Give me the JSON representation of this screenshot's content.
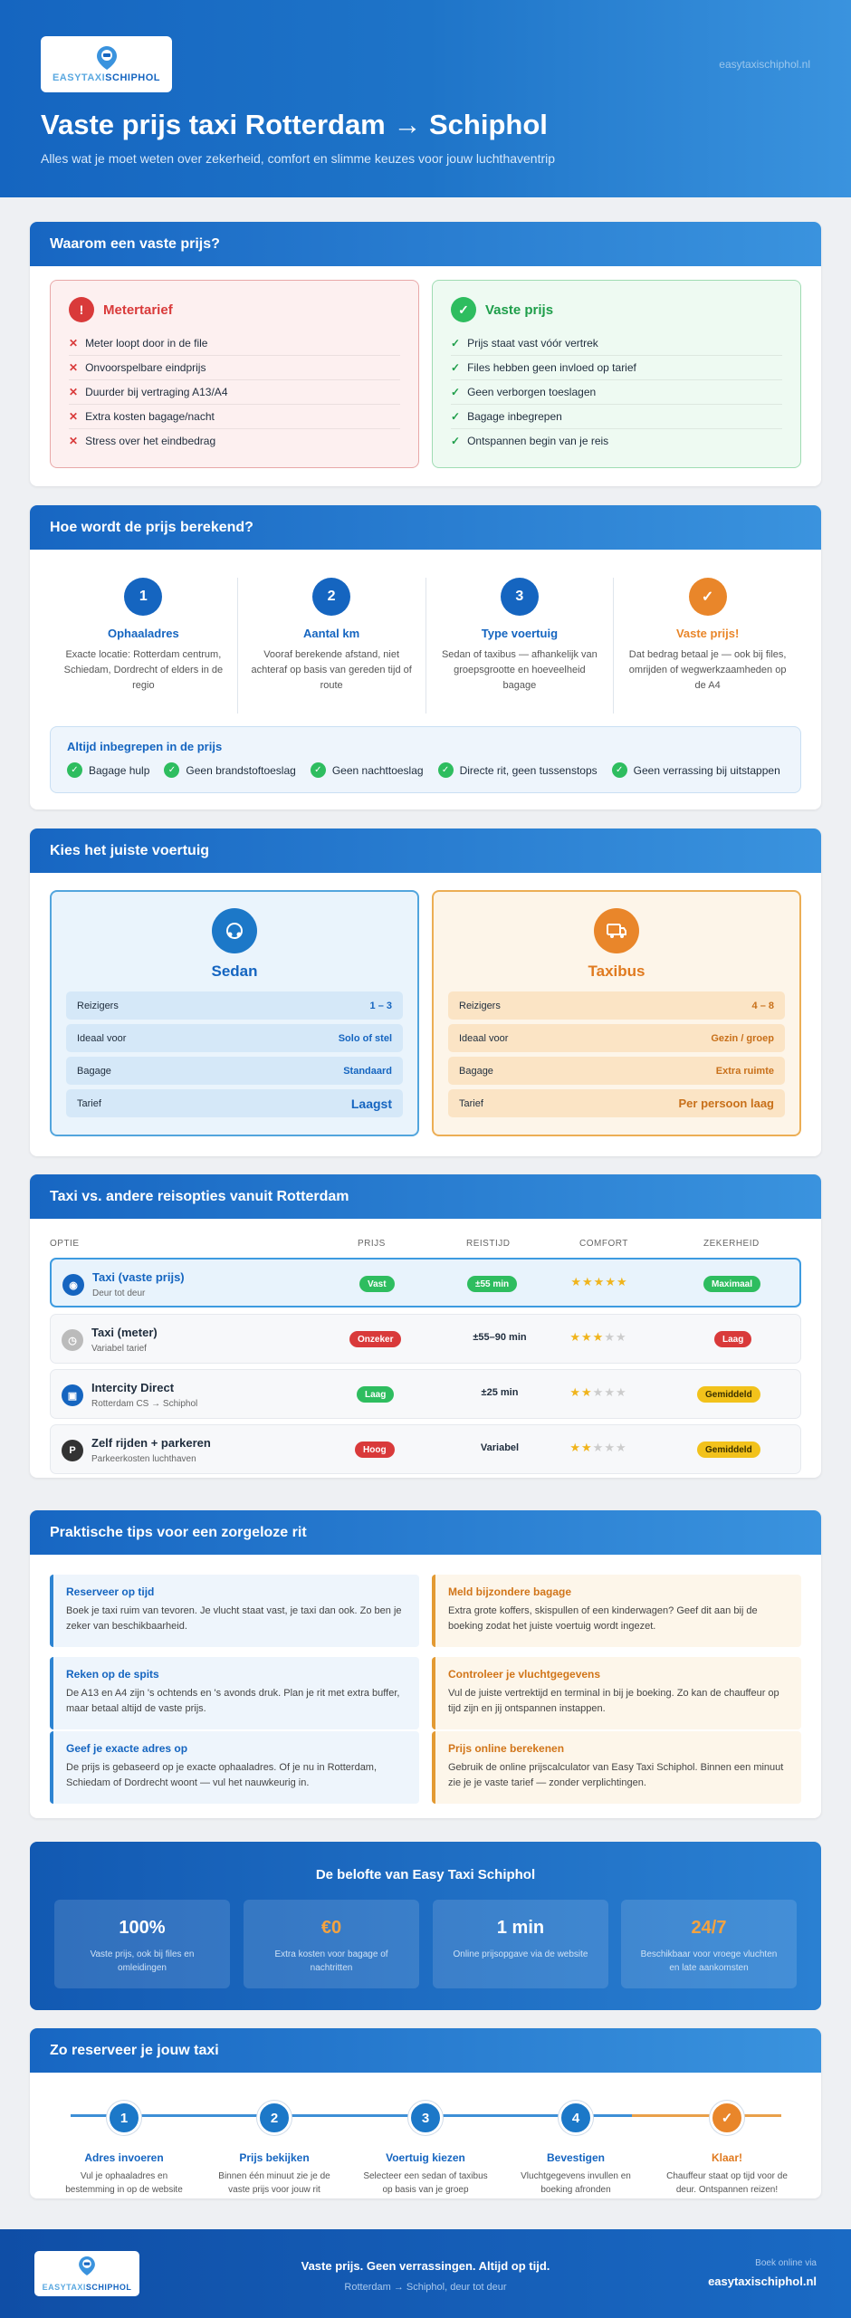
{
  "header": {
    "logo_text_a": "EASYTAXI",
    "logo_text_b": "SCHIPHOL",
    "url": "easytaxischiphol.nl",
    "title": "Vaste prijs taxi Rotterdam → Schiphol",
    "subtitle": "Alles wat je moet weten over zekerheid, comfort en slimme keuzes voor jouw luchthaventrip"
  },
  "why": {
    "heading": "Waarom een vaste prijs?",
    "meter": {
      "title": "Metertarief",
      "items": [
        "Meter loopt door in de file",
        "Onvoorspelbare eindprijs",
        "Duurder bij vertraging A13/A4",
        "Extra kosten bagage/nacht",
        "Stress over het eindbedrag"
      ]
    },
    "fixed": {
      "title": "Vaste prijs",
      "items": [
        "Prijs staat vast vóór vertrek",
        "Files hebben geen invloed op tarief",
        "Geen verborgen toeslagen",
        "Bagage inbegrepen",
        "Ontspannen begin van je reis"
      ]
    }
  },
  "calc": {
    "heading": "Hoe wordt de prijs berekend?",
    "steps": [
      {
        "num": "1",
        "title": "Ophaaladres",
        "desc": "Exacte locatie: Rotterdam centrum, Schiedam, Dordrecht of elders in de regio"
      },
      {
        "num": "2",
        "title": "Aantal km",
        "desc": "Vooraf berekende afstand, niet achteraf op basis van gereden tijd of route"
      },
      {
        "num": "3",
        "title": "Type voertuig",
        "desc": "Sedan of taxibus — afhankelijk van groepsgrootte en hoeveelheid bagage"
      },
      {
        "num": "✓",
        "title": "Vaste prijs!",
        "desc": "Dat bedrag betaal je — ook bij files, omrijden of wegwerkzaamheden op de A4"
      }
    ],
    "included_title": "Altijd inbegrepen in de prijs",
    "included": [
      "Bagage hulp",
      "Geen brandstoftoeslag",
      "Geen nachttoeslag",
      "Directe rit, geen tussenstops",
      "Geen verrassing bij uitstappen"
    ]
  },
  "vehicles": {
    "heading": "Kies het juiste voertuig",
    "sedan": {
      "name": "Sedan",
      "rows": [
        {
          "label": "Reizigers",
          "value": "1 – 3"
        },
        {
          "label": "Ideaal voor",
          "value": "Solo of stel"
        },
        {
          "label": "Bagage",
          "value": "Standaard"
        },
        {
          "label": "Tarief",
          "value": "Laagst"
        }
      ]
    },
    "bus": {
      "name": "Taxibus",
      "rows": [
        {
          "label": "Reizigers",
          "value": "4 – 8"
        },
        {
          "label": "Ideaal voor",
          "value": "Gezin / groep"
        },
        {
          "label": "Bagage",
          "value": "Extra ruimte"
        },
        {
          "label": "Tarief",
          "value": "Per persoon laag"
        }
      ]
    }
  },
  "compare": {
    "heading": "Taxi vs. andere reisopties vanuit Rotterdam",
    "columns": [
      "OPTIE",
      "PRIJS",
      "REISTIJD",
      "COMFORT",
      "ZEKERHEID"
    ],
    "rows": [
      {
        "name": "Taxi (vaste prijs)",
        "sub": "Deur tot deur",
        "price": "Vast",
        "time": "±55 min",
        "stars": "★★★★★",
        "stars_off": "",
        "certainty": "Maximaal",
        "icon": "taxi-icon",
        "icon_glyph": "◉"
      },
      {
        "name": "Taxi (meter)",
        "sub": "Variabel tarief",
        "price": "Onzeker",
        "time": "±55–90 min",
        "stars": "★★★",
        "stars_off": "★★",
        "certainty": "Laag",
        "icon": "meter-icon",
        "icon_glyph": "◷"
      },
      {
        "name": "Intercity Direct",
        "sub": "Rotterdam CS → Schiphol",
        "price": "Laag",
        "time": "±25 min",
        "stars": "★★",
        "stars_off": "★★★",
        "certainty": "Gemiddeld",
        "icon": "train-icon",
        "icon_glyph": "▣"
      },
      {
        "name": "Zelf rijden + parkeren",
        "sub": "Parkeerkosten luchthaven",
        "price": "Hoog",
        "time": "Variabel",
        "stars": "★★",
        "stars_off": "★★★",
        "certainty": "Gemiddeld",
        "icon": "parking-icon",
        "icon_glyph": "P"
      }
    ],
    "colors": {
      "green": "#2ebd5f",
      "red": "#d93a3a",
      "yellow": "#f2c21b",
      "blue": "#1565c0"
    }
  },
  "tips": {
    "heading": "Praktische tips voor een zorgeloze rit",
    "items": [
      {
        "title": "Reserveer op tijd",
        "desc": "Boek je taxi ruim van tevoren. Je vlucht staat vast, je taxi dan ook. Zo ben je zeker van beschikbaarheid."
      },
      {
        "title": "Meld bijzondere bagage",
        "desc": "Extra grote koffers, skispullen of een kinderwagen? Geef dit aan bij de boeking zodat het juiste voertuig wordt ingezet."
      },
      {
        "title": "Reken op de spits",
        "desc": "De A13 en A4 zijn 's ochtends en 's avonds druk. Plan je rit met extra buffer, maar betaal altijd de vaste prijs."
      },
      {
        "title": "Controleer je vluchtgegevens",
        "desc": "Vul de juiste vertrektijd en terminal in bij je boeking. Zo kan de chauffeur op tijd zijn en jij ontspannen instappen."
      },
      {
        "title": "Geef je exacte adres op",
        "desc": "De prijs is gebaseerd op je exacte ophaaladres. Of je nu in Rotterdam, Schiedam of Dordrecht woont — vul het nauwkeurig in."
      },
      {
        "title": "Prijs online berekenen",
        "desc": "Gebruik de online prijscalculator van Easy Taxi Schiphol. Binnen een minuut zie je je vaste tarief — zonder verplichtingen."
      }
    ]
  },
  "promise": {
    "title": "De belofte van Easy Taxi Schiphol",
    "items": [
      {
        "big": "100%",
        "small": "Vaste prijs, ook bij files en omleidingen",
        "color": "#ffffff"
      },
      {
        "big": "€0",
        "small": "Extra kosten voor bagage of nachtritten",
        "color": "#f5a340"
      },
      {
        "big": "1 min",
        "small": "Online prijsopgave via de website",
        "color": "#ffffff"
      },
      {
        "big": "24/7",
        "small": "Beschikbaar voor vroege vluchten en late aankomsten",
        "color": "#f5a340"
      }
    ]
  },
  "reserve": {
    "heading": "Zo reserveer je jouw taxi",
    "steps": [
      {
        "num": "1",
        "title": "Adres invoeren",
        "desc": "Vul je ophaaladres en bestemming in op de website"
      },
      {
        "num": "2",
        "title": "Prijs bekijken",
        "desc": "Binnen één minuut zie je de vaste prijs voor jouw rit"
      },
      {
        "num": "3",
        "title": "Voertuig kiezen",
        "desc": "Selecteer een sedan of taxibus op basis van je groep"
      },
      {
        "num": "4",
        "title": "Bevestigen",
        "desc": "Vluchtgegevens invullen en boeking afronden"
      },
      {
        "num": "✓",
        "title": "Klaar!",
        "desc": "Chauffeur staat op tijd voor de deur. Ontspannen reizen!"
      }
    ]
  },
  "footer": {
    "tagline": "Vaste prijs. Geen verrassingen. Altijd op tijd.",
    "sub": "Rotterdam → Schiphol, deur tot deur",
    "book_label": "Boek online via",
    "url": "easytaxischiphol.nl"
  }
}
